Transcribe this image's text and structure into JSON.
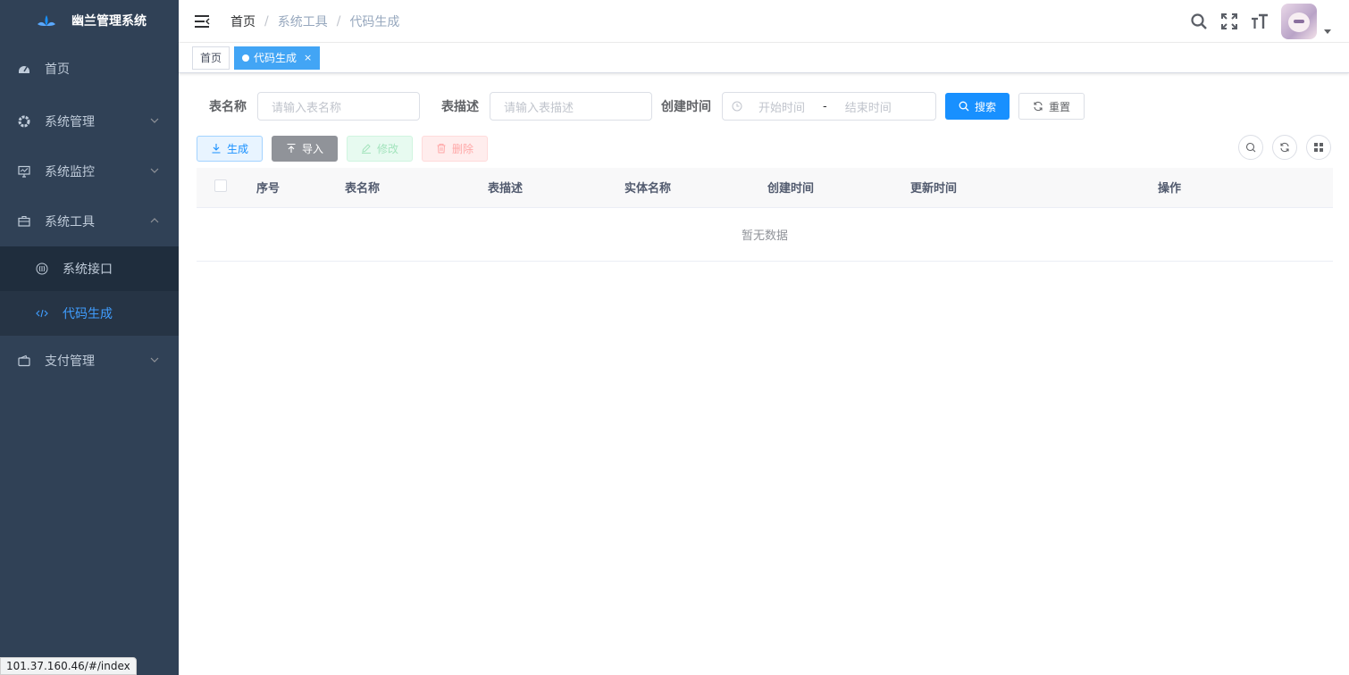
{
  "app": {
    "title": "幽兰管理系统"
  },
  "sidebar": {
    "items": [
      {
        "label": "首页",
        "icon": "dashboard-icon"
      },
      {
        "label": "系统管理",
        "icon": "gear-icon"
      },
      {
        "label": "系统监控",
        "icon": "monitor-icon"
      },
      {
        "label": "系统工具",
        "icon": "toolbox-icon"
      },
      {
        "label": "支付管理",
        "icon": "wallet-icon"
      }
    ],
    "subitems": [
      {
        "label": "系统接口",
        "icon": "api-icon"
      },
      {
        "label": "代码生成",
        "icon": "code-icon",
        "active": true
      }
    ]
  },
  "breadcrumb": [
    "首页",
    "系统工具",
    "代码生成"
  ],
  "tags": [
    {
      "label": "首页"
    },
    {
      "label": "代码生成",
      "active": true,
      "close": "×"
    }
  ],
  "search": {
    "table_name_label": "表名称",
    "table_name_placeholder": "请输入表名称",
    "table_desc_label": "表描述",
    "table_desc_placeholder": "请输入表描述",
    "create_time_label": "创建时间",
    "start_placeholder": "开始时间",
    "range_sep": "-",
    "end_placeholder": "结束时间",
    "search_btn": "搜索",
    "reset_btn": "重置"
  },
  "toolbar": {
    "generate": "生成",
    "import": "导入",
    "edit": "修改",
    "delete": "删除"
  },
  "table": {
    "headers": [
      "序号",
      "表名称",
      "表描述",
      "实体名称",
      "创建时间",
      "更新时间",
      "操作"
    ],
    "empty_text": "暂无数据"
  },
  "status_bar": {
    "url": "101.37.160.46/#/index"
  },
  "colors": {
    "sidebar_bg": "#304156",
    "primary": "#1890ff",
    "active_text": "#409eff"
  }
}
